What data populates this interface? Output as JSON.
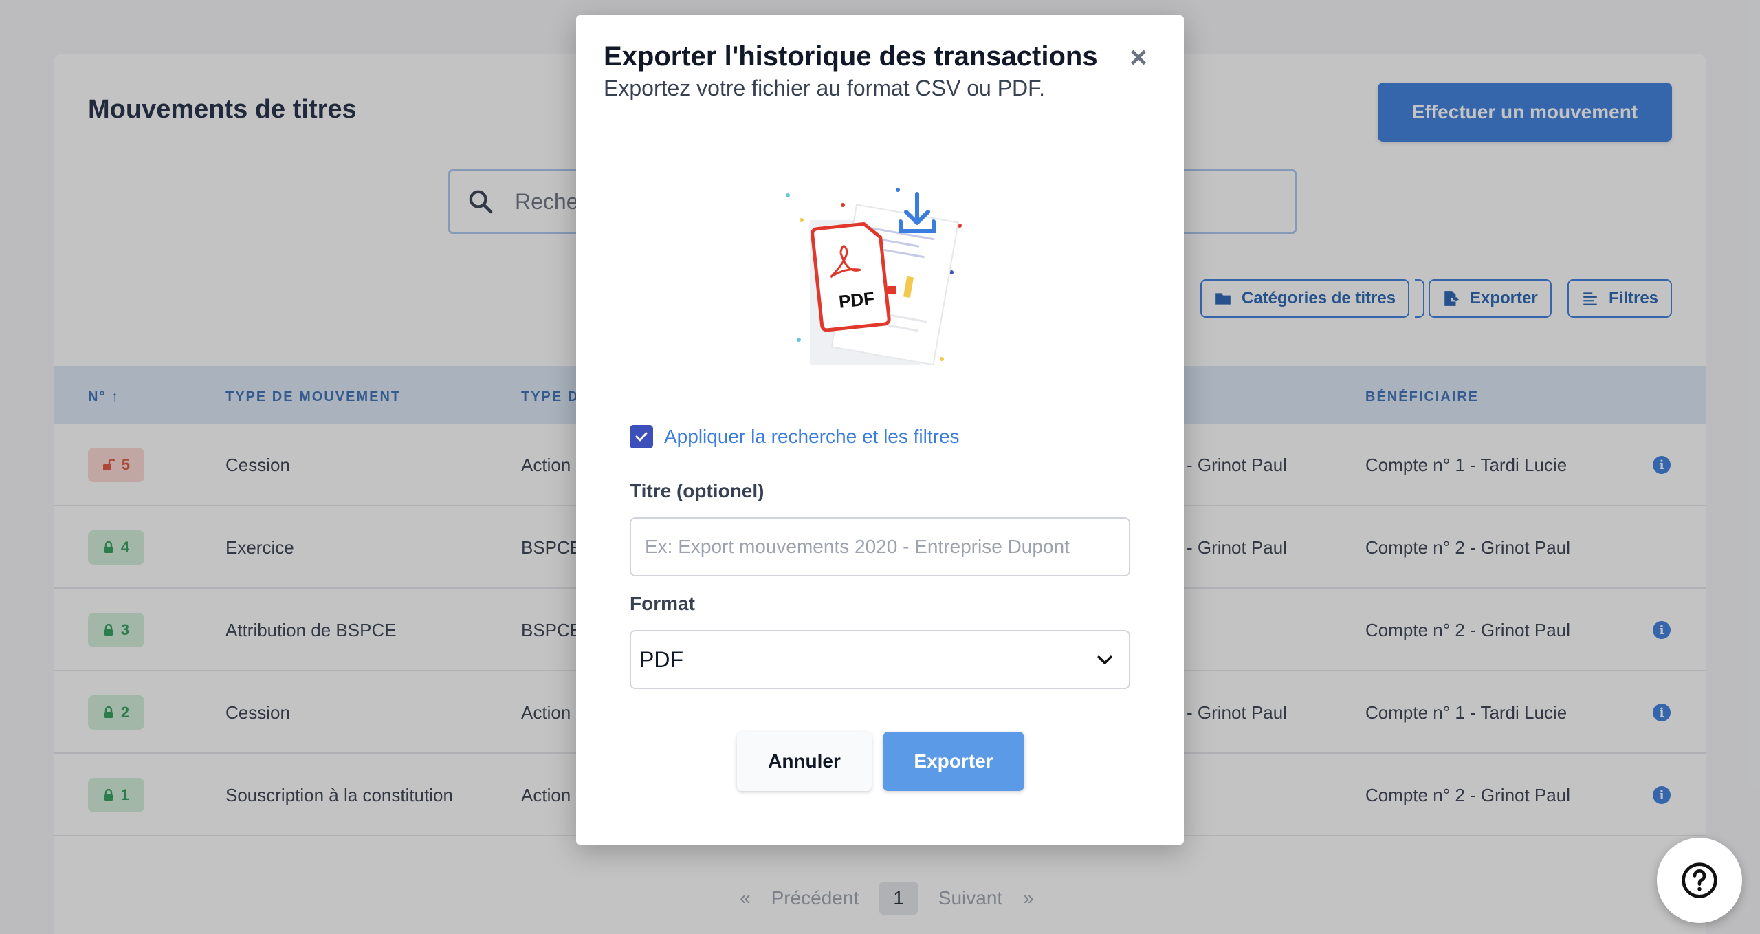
{
  "page": {
    "title": "Mouvements de titres",
    "primary_action": "Effectuer un mouvement",
    "search_placeholder": "Recher",
    "toolbar": {
      "categories": "Catégories de titres",
      "export": "Exporter",
      "filters": "Filtres"
    },
    "table": {
      "headers": {
        "number": "N°",
        "movement_type": "TYPE DE MOUVEMENT",
        "security_type": "TYPE D",
        "beneficiary": "BÉNÉFICIAIRE"
      },
      "rows": [
        {
          "number": "5",
          "locked": false,
          "movement_type": "Cession",
          "security_type": "Action",
          "from": "- Grinot Paul",
          "beneficiary": "Compte n° 1 - Tardi Lucie",
          "info": true
        },
        {
          "number": "4",
          "locked": true,
          "movement_type": "Exercice",
          "security_type": "BSPCE",
          "from": "- Grinot Paul",
          "beneficiary": "Compte n° 2 - Grinot Paul",
          "info": false
        },
        {
          "number": "3",
          "locked": true,
          "movement_type": "Attribution de BSPCE",
          "security_type": "BSPCE",
          "from": "",
          "beneficiary": "Compte n° 2 - Grinot Paul",
          "info": true
        },
        {
          "number": "2",
          "locked": true,
          "movement_type": "Cession",
          "security_type": "Action",
          "from": "- Grinot Paul",
          "beneficiary": "Compte n° 1 - Tardi Lucie",
          "info": true
        },
        {
          "number": "1",
          "locked": true,
          "movement_type": "Souscription à la constitution",
          "security_type": "Action",
          "from": "",
          "beneficiary": "Compte n° 2 - Grinot Paul",
          "info": true
        }
      ]
    },
    "pagination": {
      "first": "«",
      "prev": "Précédent",
      "current": "1",
      "next": "Suivant",
      "last": "»"
    }
  },
  "modal": {
    "title": "Exporter l'historique des transactions",
    "subtitle": "Exportez votre fichier au format CSV ou PDF.",
    "close": "×",
    "illustration_label": "PDF",
    "apply_filters_label": "Appliquer la recherche et les filtres",
    "apply_filters_checked": true,
    "title_field_label": "Titre (optionel)",
    "title_field_placeholder": "Ex: Export mouvements 2020 - Entreprise Dupont",
    "title_field_value": "",
    "format_label": "Format",
    "format_value": "PDF",
    "cancel_label": "Annuler",
    "export_label": "Exporter"
  },
  "colors": {
    "accent": "#3b7ddd",
    "checkbox": "#3d4fb8",
    "pdf_red": "#e0392b",
    "locked_green": "#2f9e5b",
    "unlocked_red": "#e0533f"
  }
}
